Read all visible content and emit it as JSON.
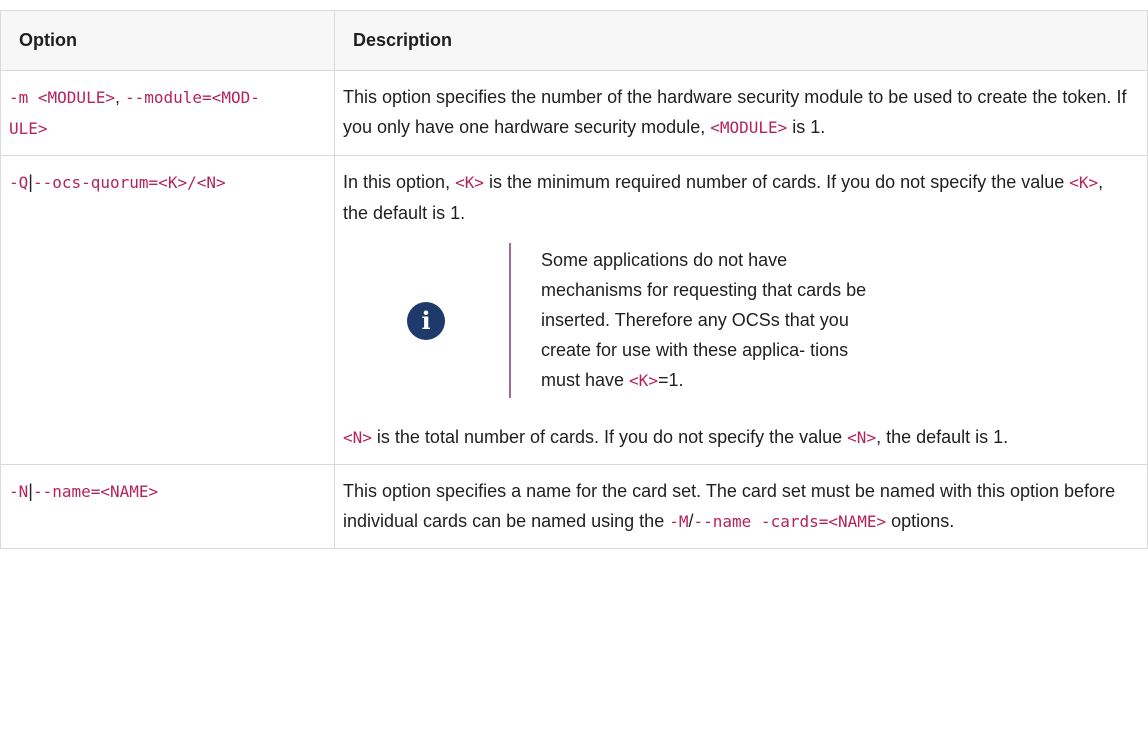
{
  "headers": {
    "option": "Option",
    "description": "Description"
  },
  "rows": [
    {
      "opt_a": "-m <MODULE>",
      "opt_sep": ", ",
      "opt_b": "--module=<MOD-",
      "opt_c": "ULE>",
      "desc_1": "This option specifies the number of the hardware security module to be used to create the token. If you only have one hardware security module, ",
      "desc_code": "<MODULE>",
      "desc_2": " is 1."
    },
    {
      "opt_a": "-Q",
      "opt_sep": "|",
      "opt_b": "--ocs-quorum=<K>/<N>",
      "p1_1": "In this option, ",
      "p1_code1": "<K>",
      "p1_2": " is the minimum required number of cards. If you do not specify the value ",
      "p1_code2": "<K>",
      "p1_3": ", the default is 1.",
      "note_icon": "info-icon",
      "note_1": "Some applications do not have mechanisms for requesting that cards be inserted. Therefore any OCSs that you create for use with these applica- tions must have ",
      "note_code": "<K>",
      "note_2": "=1.",
      "p2_code1": "<N>",
      "p2_1": " is the total number of cards. If you do not specify the value ",
      "p2_code2": "<N>",
      "p2_2": ", the default is 1."
    },
    {
      "opt_a": "-N",
      "opt_sep": "|",
      "opt_b": "--name=<NAME>",
      "desc_1": "This option specifies a name for the card set. The card set must be named with this option before individual cards can be named using the ",
      "desc_code1": "-M",
      "desc_sep": "/",
      "desc_code2": "--name -cards=<NAME>",
      "desc_2": " options."
    }
  ]
}
